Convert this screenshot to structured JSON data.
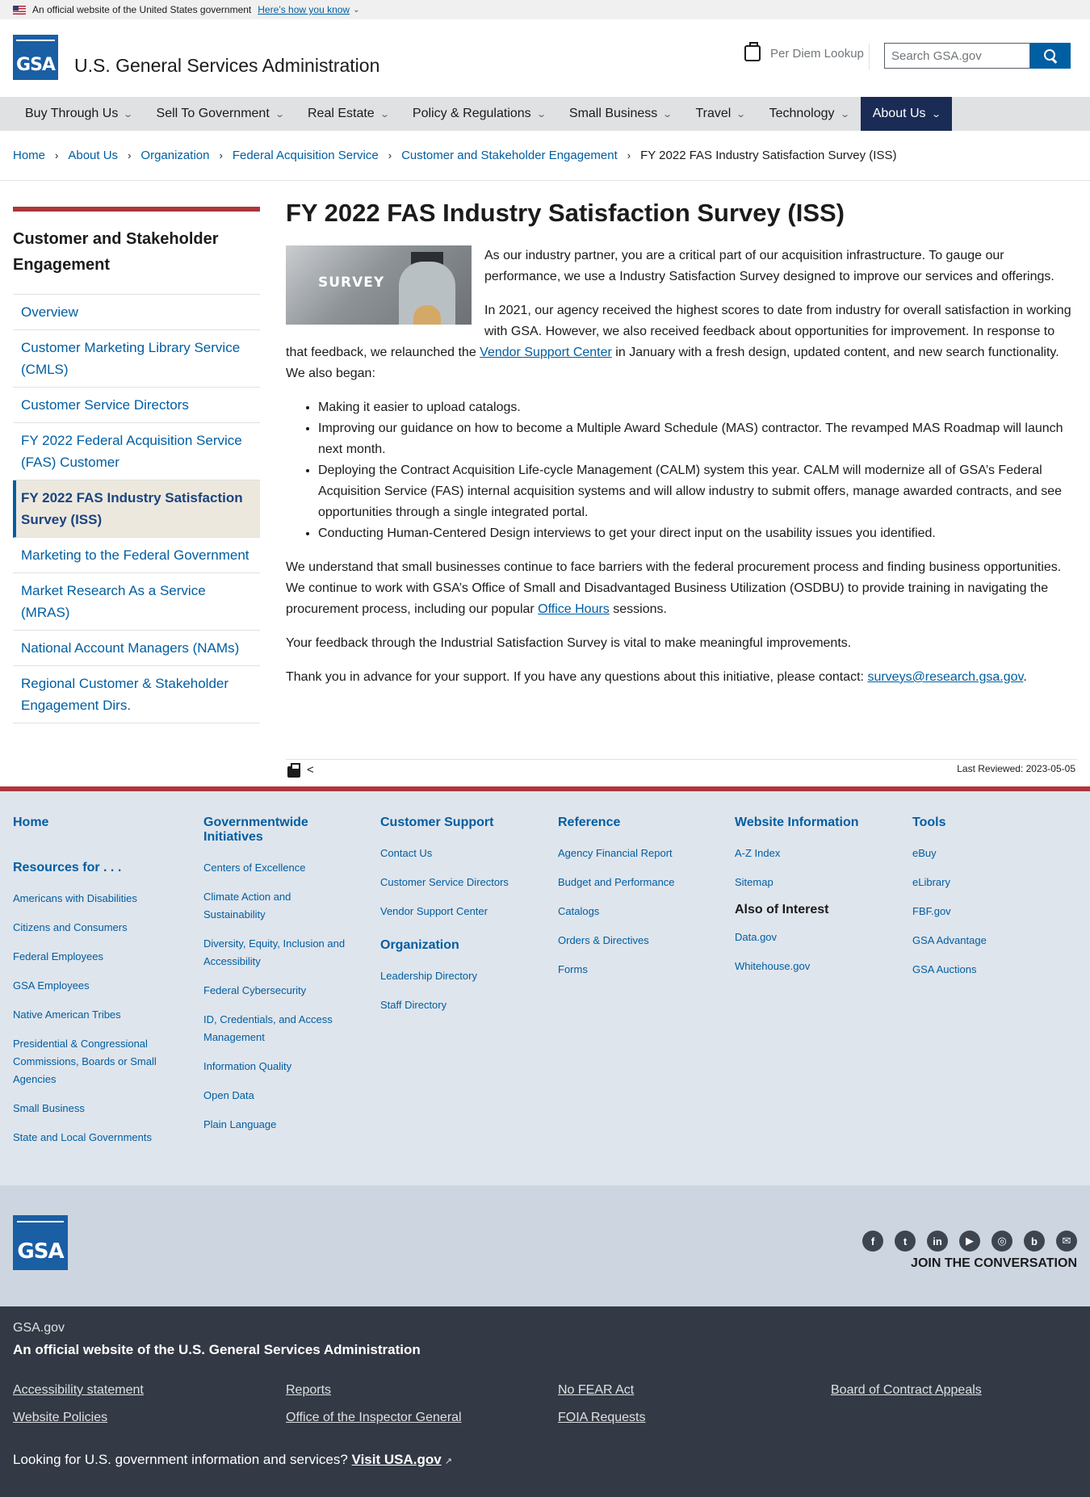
{
  "banner": {
    "text": "An official website of the United States government",
    "link": "Here’s how you know"
  },
  "header": {
    "agency": "U.S. General Services Administration",
    "logo_text": "GSA",
    "per_diem": "Per Diem Lookup",
    "search_placeholder": "Search GSA.gov"
  },
  "nav": [
    {
      "label": "Buy Through Us"
    },
    {
      "label": "Sell To Government"
    },
    {
      "label": "Real Estate"
    },
    {
      "label": "Policy & Regulations"
    },
    {
      "label": "Small Business"
    },
    {
      "label": "Travel"
    },
    {
      "label": "Technology"
    },
    {
      "label": "About Us"
    }
  ],
  "breadcrumb": [
    "Home",
    "About Us",
    "Organization",
    "Federal Acquisition Service",
    "Customer and Stakeholder Engagement",
    "FY 2022 FAS Industry Satisfaction Survey (ISS)"
  ],
  "sidebar": {
    "title": "Customer and Stakeholder Engagement",
    "items": [
      "Overview",
      "Customer Marketing Library Service (CMLS)",
      "Customer Service Directors",
      "FY 2022 Federal Acquisition Service (FAS) Customer",
      "FY 2022 FAS Industry Satisfaction Survey (ISS)",
      "Marketing to the Federal Government",
      "Market Research As a Service (MRAS)",
      "National Account Managers (NAMs)",
      "Regional Customer & Stakeholder Engagement Dirs."
    ]
  },
  "main": {
    "title": "FY 2022 FAS Industry Satisfaction Survey (ISS)",
    "image_text": "SURVEY",
    "p1": "As our industry partner, you are a critical part of our acquisition infrastructure. To gauge our performance, we use a Industry Satisfaction Survey designed to improve our services and offerings.",
    "p2_a": "In 2021, our agency received the highest scores to date from industry for overall satisfaction in working with GSA. However, we also received feedback about opportunities for improvement. In response to that feedback, we relaunched the ",
    "p2_link": "Vendor Support Center",
    "p2_b": " in January with a fresh design, updated content, and new search functionality. We also began:",
    "bullets": [
      "Making it easier to upload catalogs.",
      "Improving our guidance on how to become a Multiple Award Schedule (MAS) contractor. The revamped MAS Roadmap will launch next month.",
      "Deploying the Contract Acquisition Life-cycle Management (CALM) system this year. CALM will modernize all of GSA’s Federal Acquisition Service (FAS) internal acquisition systems and will allow industry to submit offers, manage awarded contracts, and see opportunities through a single integrated portal.",
      "Conducting Human-Centered Design interviews to get your direct input on the usability issues you identified."
    ],
    "p3_a": "We understand that small businesses continue to face barriers with the federal procurement process and finding business opportunities. We continue to work with GSA’s Office of Small and Disadvantaged Business Utilization (OSDBU) to provide training in navigating the procurement process, including our popular ",
    "p3_link": "Office Hours",
    "p3_b": " sessions.",
    "p4": "Your feedback through the Industrial Satisfaction Survey is vital to make meaningful improvements.",
    "p5_a": "Thank you in advance for your support. If you have any questions about this initiative, please contact: ",
    "p5_link": "surveys@research.gsa.gov",
    "p5_b": ".",
    "last_reviewed": "Last Reviewed: 2023-05-05"
  },
  "footer": {
    "home": "Home",
    "resources_title": "Resources for . . .",
    "resources": [
      "Americans with Disabilities",
      "Citizens and Consumers",
      "Federal Employees",
      "GSA Employees",
      "Native American Tribes",
      "Presidential & Congressional Commissions, Boards or Small Agencies",
      "Small Business",
      "State and Local Governments"
    ],
    "gov_title": "Governmentwide Initiatives",
    "gov": [
      "Centers of Excellence",
      "Climate Action and Sustainability",
      "Diversity, Equity, Inclusion and Accessibility",
      "Federal Cybersecurity",
      "ID, Credentials, and Access Management",
      "Information Quality",
      "Open Data",
      "Plain Language"
    ],
    "support_title": "Customer Support",
    "support": [
      "Contact Us",
      "Customer Service Directors",
      "Vendor Support Center"
    ],
    "org_title": "Organization",
    "org": [
      "Leadership Directory",
      "Staff Directory"
    ],
    "ref_title": "Reference",
    "ref": [
      "Agency Financial Report",
      "Budget and Performance",
      "Catalogs",
      "Orders & Directives",
      "Forms"
    ],
    "web_title": "Website Information",
    "web": [
      "A-Z Index",
      "Sitemap"
    ],
    "interest_title": "Also of Interest",
    "interest": [
      "Data.gov",
      "Whitehouse.gov"
    ],
    "tools_title": "Tools",
    "tools": [
      "eBuy",
      "eLibrary",
      "FBF.gov",
      "GSA Advantage",
      "GSA Auctions"
    ],
    "join": "JOIN THE CONVERSATION",
    "social": [
      "facebook-icon",
      "twitter-icon",
      "linkedin-icon",
      "youtube-icon",
      "instagram-icon",
      "blog-icon",
      "email-icon"
    ],
    "site": "GSA.gov",
    "official": "An official website of the U.S. General Services Administration",
    "links": [
      "Accessibility statement",
      "Reports",
      "No FEAR Act",
      "Board of Contract Appeals",
      "Website Policies",
      "Office of the Inspector General",
      "FOIA Requests"
    ],
    "usa_text": "Looking for U.S. government information and services? ",
    "usa_link": "Visit USA.gov"
  }
}
